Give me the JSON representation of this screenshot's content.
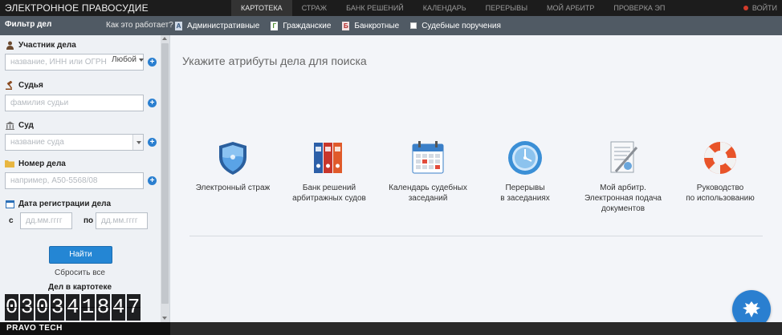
{
  "topbar": {
    "brand": "ЭЛЕКТРОННОЕ ПРАВОСУДИЕ",
    "nav": [
      "КАРТОТЕКА",
      "СТРАЖ",
      "БАНК РЕШЕНИЙ",
      "КАЛЕНДАРЬ",
      "ПЕРЕРЫВЫ",
      "МОЙ АРБИТР",
      "ПРОВЕРКА ЭП"
    ],
    "active_nav": "КАРТОТЕКА",
    "login": "ВОЙТИ"
  },
  "subbar": {
    "filter_title": "Фильтр дел",
    "how_it_works": "Как это работает?",
    "types": [
      {
        "label": "Административные",
        "icon_letter": "А"
      },
      {
        "label": "Гражданские",
        "icon_letter": "Г"
      },
      {
        "label": "Банкротные",
        "icon_letter": "Б"
      },
      {
        "label": "Судебные поручения",
        "icon_letter": ""
      }
    ]
  },
  "sidebar": {
    "participant": {
      "label": "Участник дела",
      "placeholder": "название, ИНН или ОГРН",
      "mode": "Любой"
    },
    "judge": {
      "label": "Судья",
      "placeholder": "фамилия судьи"
    },
    "court": {
      "label": "Суд",
      "placeholder": "название суда"
    },
    "case_number": {
      "label": "Номер дела",
      "placeholder": "например, А50-5568/08"
    },
    "reg_date": {
      "label": "Дата регистрации дела",
      "from_label": "с",
      "to_label": "по",
      "from_placeholder": "дд.мм.гггг",
      "to_placeholder": "дд.мм.гггг"
    },
    "find_button": "Найти",
    "reset": "Сбросить все",
    "count_title": "Дел в картотеке",
    "count_digits": [
      "0",
      "3",
      "0",
      "3",
      "4",
      "1",
      "8",
      "4",
      "7"
    ]
  },
  "main": {
    "title": "Укажите атрибуты дела для поиска",
    "cards": [
      {
        "line1": "Электронный страж",
        "line2": "",
        "line3": ""
      },
      {
        "line1": "Банк решений",
        "line2": "арбитражных судов",
        "line3": ""
      },
      {
        "line1": "Календарь судебных",
        "line2": "заседаний",
        "line3": ""
      },
      {
        "line1": "Перерывы",
        "line2": "в заседаниях",
        "line3": ""
      },
      {
        "line1": "Мой арбитр.",
        "line2": "Электронная подача",
        "line3": "документов"
      },
      {
        "line1": "Руководство",
        "line2": "по использованию",
        "line3": ""
      }
    ]
  },
  "bottombar": {
    "brand": "PRAVO TECH"
  },
  "colors": {
    "accent": "#2a7fd0",
    "topbar": "#1c1c1c",
    "subbar": "#505a64"
  }
}
